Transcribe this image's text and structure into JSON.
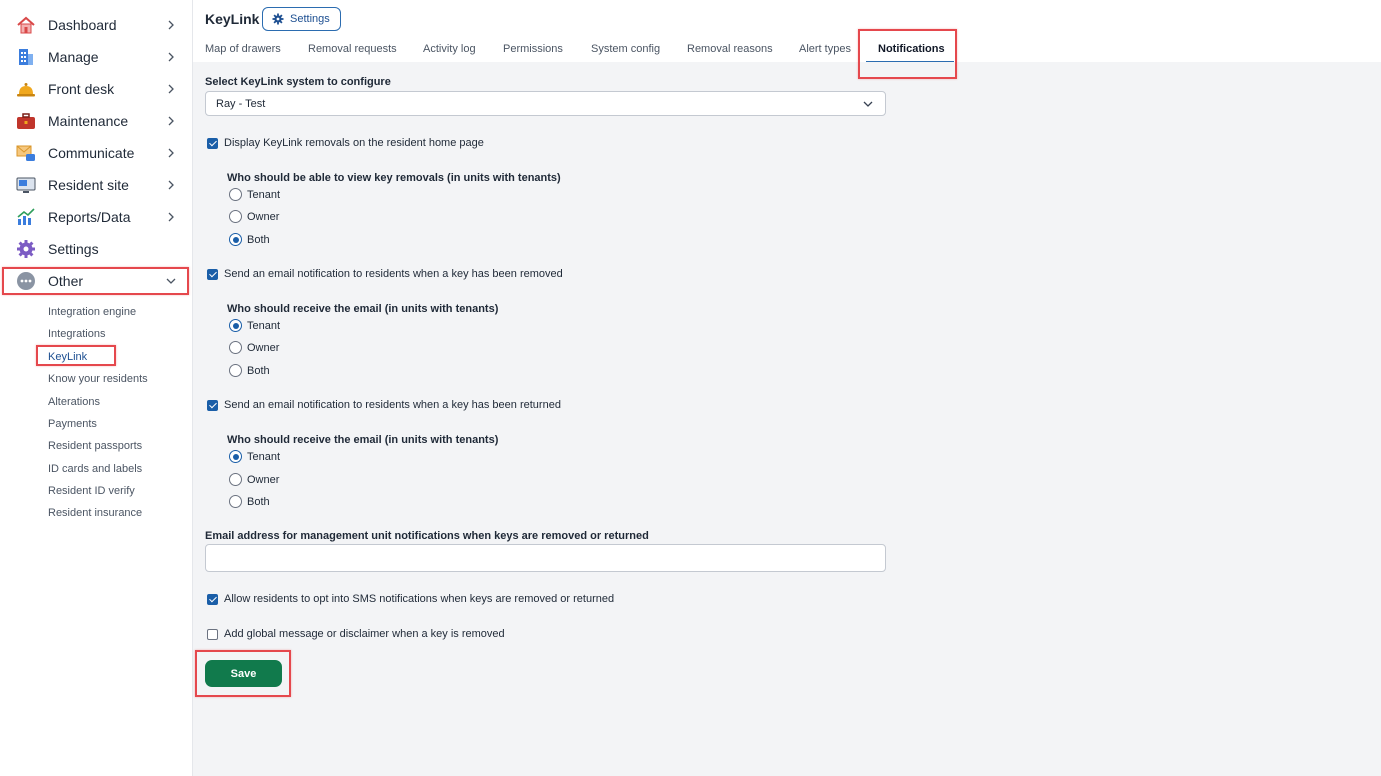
{
  "sidebar": {
    "items": [
      {
        "label": "Dashboard",
        "icon": "house-icon"
      },
      {
        "label": "Manage",
        "icon": "building-icon"
      },
      {
        "label": "Front desk",
        "icon": "bell-icon"
      },
      {
        "label": "Maintenance",
        "icon": "toolbox-icon"
      },
      {
        "label": "Communicate",
        "icon": "envelope-chat-icon"
      },
      {
        "label": "Resident site",
        "icon": "monitor-icon"
      },
      {
        "label": "Reports/Data",
        "icon": "chart-icon"
      },
      {
        "label": "Settings",
        "icon": "gear-icon"
      },
      {
        "label": "Other",
        "icon": "more-dots-icon"
      }
    ],
    "subitems": [
      "Integration engine",
      "Integrations",
      "KeyLink",
      "Know your residents",
      "Alterations",
      "Payments",
      "Resident passports",
      "ID cards and labels",
      "Resident ID verify",
      "Resident insurance"
    ]
  },
  "header": {
    "title": "KeyLink",
    "settings_label": "Settings",
    "tabs": [
      "Map of drawers",
      "Removal requests",
      "Activity log",
      "Permissions",
      "System config",
      "Removal reasons",
      "Alert types",
      "Notifications"
    ]
  },
  "form": {
    "system_label": "Select KeyLink system to configure",
    "system_value": "Ray - Test",
    "display_removals": {
      "label": "Display KeyLink removals on the resident home page",
      "checked": true
    },
    "view_removals": {
      "label": "Who should be able to view key removals (in units with tenants)",
      "options": [
        "Tenant",
        "Owner",
        "Both"
      ],
      "selected": "Both"
    },
    "email_removed": {
      "label": "Send an email notification to residents when a key has been removed",
      "checked": true
    },
    "receive_removed": {
      "label": "Who should receive the email (in units with tenants)",
      "options": [
        "Tenant",
        "Owner",
        "Both"
      ],
      "selected": "Tenant"
    },
    "email_returned": {
      "label": "Send an email notification to residents when a key has been returned",
      "checked": true
    },
    "receive_returned": {
      "label": "Who should receive the email (in units with tenants)",
      "options": [
        "Tenant",
        "Owner",
        "Both"
      ],
      "selected": "Tenant"
    },
    "mgmt_email_label": "Email address for management unit notifications when keys are removed or returned",
    "mgmt_email_value": "",
    "sms_optin": {
      "label": "Allow residents to opt into SMS notifications when keys are removed or returned",
      "checked": true
    },
    "global_message": {
      "label": "Add global message or disclaimer when a key is removed",
      "checked": false
    },
    "save_label": "Save"
  },
  "colors": {
    "accent": "#1a5ea8",
    "save": "#117a4c",
    "highlight": "#e5484d"
  }
}
